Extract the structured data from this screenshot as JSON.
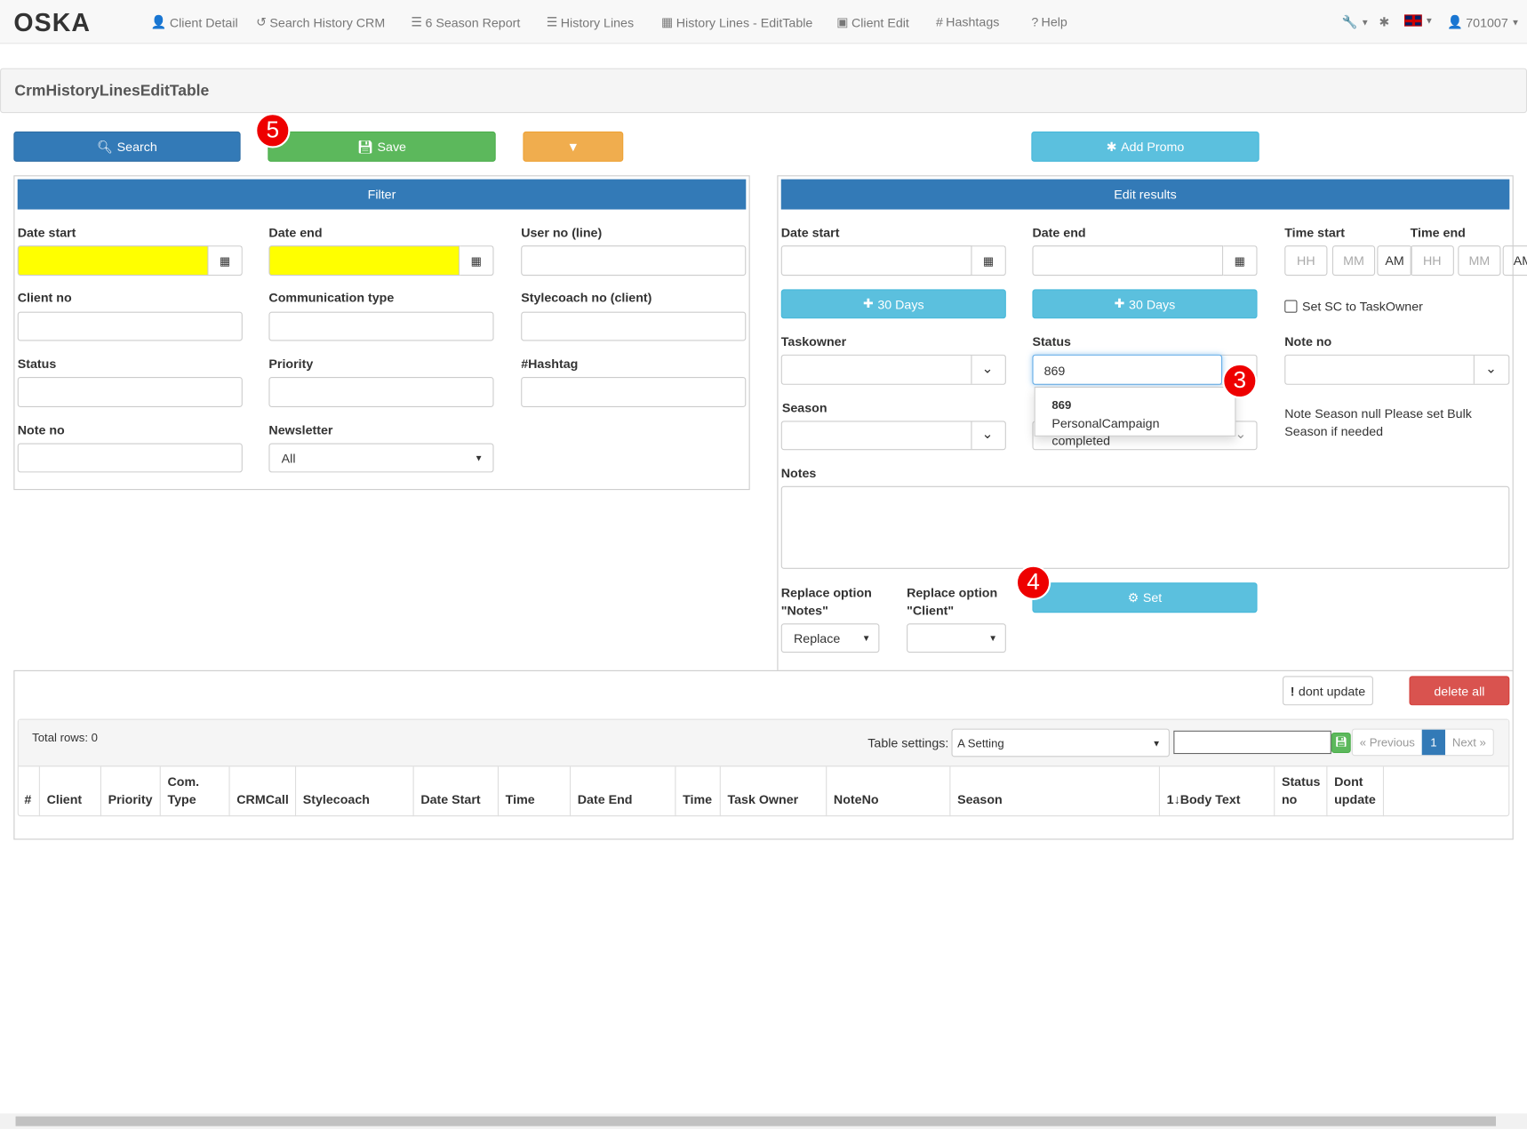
{
  "nav": {
    "logo": "OSKA",
    "links": [
      "Client Detail",
      "Search History CRM",
      "6 Season Report",
      "History Lines",
      "History Lines - EditTable",
      "Client Edit",
      "Hashtags",
      "Help"
    ],
    "user": "701007"
  },
  "page_title": "CrmHistoryLinesEditTable",
  "toolbar": {
    "search": "Search",
    "save": "Save",
    "add_promo": "Add Promo"
  },
  "badges": {
    "save": "5",
    "status": "3",
    "set": "4"
  },
  "filter": {
    "title": "Filter",
    "date_start": "Date start",
    "date_end": "Date end",
    "user_no": "User no (line)",
    "client_no": "Client no",
    "communication_type": "Communication type",
    "stylecoach_no": "Stylecoach no (client)",
    "status": "Status",
    "priority": "Priority",
    "hashtag": "#Hashtag",
    "note_no": "Note no",
    "newsletter": "Newsletter",
    "newsletter_value": "All"
  },
  "edit": {
    "title": "Edit results",
    "date_start": "Date start",
    "date_end": "Date end",
    "time_start": "Time start",
    "time_end": "Time end",
    "hh": "HH",
    "mm": "MM",
    "am": "AM",
    "plus30": "30 Days",
    "set_sc": "Set SC to TaskOwner",
    "taskowner": "Taskowner",
    "status": "Status",
    "status_value": "869",
    "note_no": "Note no",
    "season": "Season",
    "season_note": "Note Season null Please set Bulk Season if needed",
    "notes": "Notes",
    "replace_notes": "Replace option \"Notes\"",
    "replace_client": "Replace option \"Client\"",
    "replace_value": "Replace",
    "set": "Set",
    "suggestion": {
      "code": "869",
      "text": "PersonalCampaign completed"
    }
  },
  "results": {
    "dont_update": "dont update",
    "delete_all": "delete all",
    "total_rows": "Total rows: 0",
    "table_settings": "Table settings:",
    "setting_value": "A Setting",
    "prev": "« Previous",
    "page": "1",
    "next": "Next »",
    "columns": [
      "#",
      "Client",
      "Priority",
      "Com. Type",
      "CRMCall",
      "Stylecoach",
      "Date Start",
      "Time",
      "Date End",
      "Time",
      "Task Owner",
      "NoteNo",
      "Season",
      "1↓Body Text",
      "Status no",
      "Dont update"
    ]
  }
}
